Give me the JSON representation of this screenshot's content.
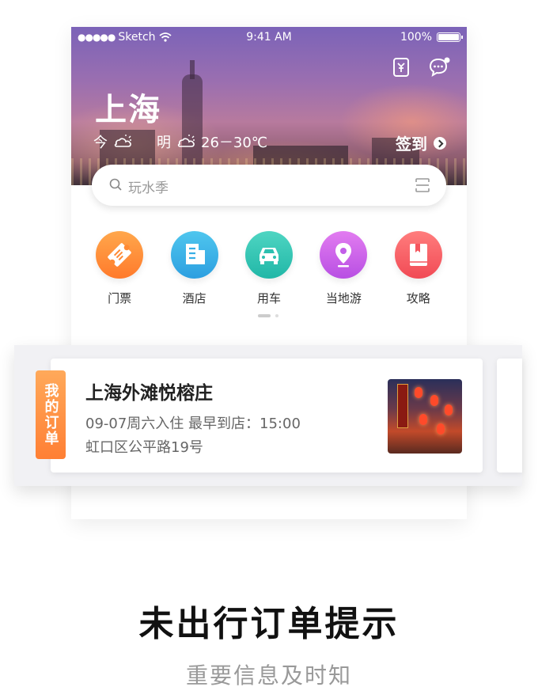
{
  "status_bar": {
    "carrier": "Sketch",
    "time": "9:41 AM",
    "battery": "100%"
  },
  "header": {
    "city": "上海",
    "today_label": "今",
    "tomorrow_label": "明",
    "temperature": "26－30℃",
    "checkin_label": "签到"
  },
  "search": {
    "placeholder": "玩水季"
  },
  "categories": [
    {
      "label": "门票",
      "icon": "ticket-icon",
      "color": "#ff8a35"
    },
    {
      "label": "酒店",
      "icon": "hotel-icon",
      "color": "#36aee6"
    },
    {
      "label": "用车",
      "icon": "car-icon",
      "color": "#2cc0b0"
    },
    {
      "label": "当地游",
      "icon": "location-pin-icon",
      "color": "#c25ee8"
    },
    {
      "label": "攻略",
      "icon": "guidebook-icon",
      "color": "#f5555e"
    }
  ],
  "order_card": {
    "tag": "我的订单",
    "hotel_name": "上海外滩悦榕庄",
    "checkin_info": "09-07周六入住   最早到店：15:00",
    "address": "虹口区公平路19号"
  },
  "promo": {
    "headline": "未出行订单提示",
    "subline": "重要信息及时知"
  }
}
